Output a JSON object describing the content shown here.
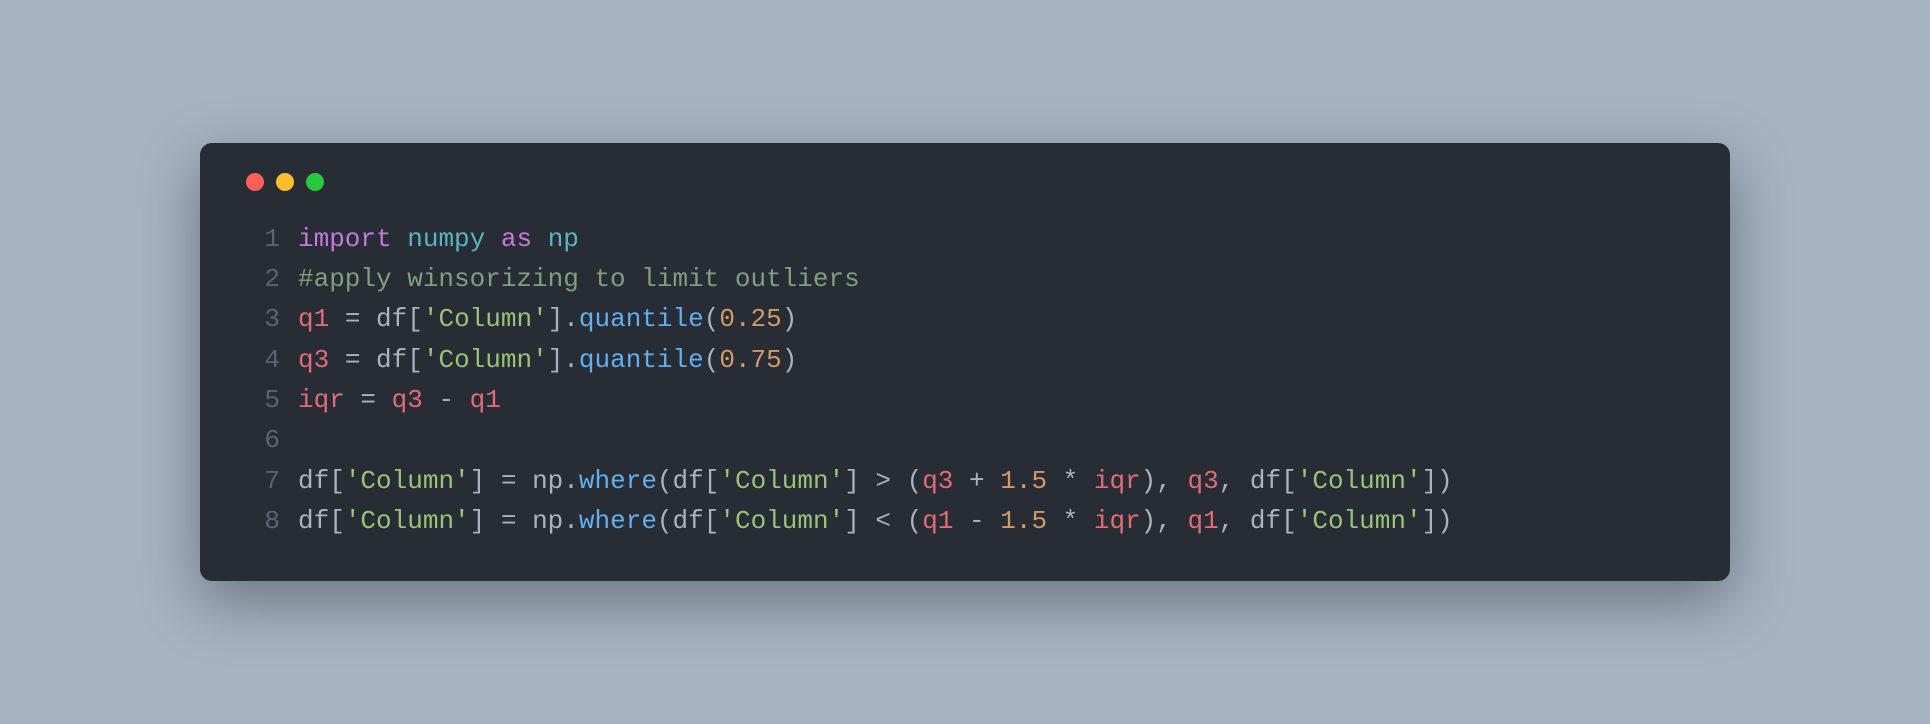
{
  "window": {
    "traffic_lights": [
      "close",
      "minimize",
      "zoom"
    ]
  },
  "code": {
    "lines": [
      {
        "n": "1",
        "tokens": [
          {
            "t": "import",
            "c": "kw"
          },
          {
            "t": " ",
            "c": "punct"
          },
          {
            "t": "numpy",
            "c": "mod"
          },
          {
            "t": " ",
            "c": "punct"
          },
          {
            "t": "as",
            "c": "as"
          },
          {
            "t": " ",
            "c": "punct"
          },
          {
            "t": "np",
            "c": "alias"
          }
        ]
      },
      {
        "n": "2",
        "tokens": [
          {
            "t": "#apply winsorizing to limit outliers",
            "c": "comment"
          }
        ]
      },
      {
        "n": "3",
        "tokens": [
          {
            "t": "q1",
            "c": "var"
          },
          {
            "t": " = ",
            "c": "op"
          },
          {
            "t": "df",
            "c": "obj"
          },
          {
            "t": "[",
            "c": "punct"
          },
          {
            "t": "'Column'",
            "c": "str"
          },
          {
            "t": "].",
            "c": "punct"
          },
          {
            "t": "quantile",
            "c": "func"
          },
          {
            "t": "(",
            "c": "punct"
          },
          {
            "t": "0.25",
            "c": "num"
          },
          {
            "t": ")",
            "c": "punct"
          }
        ]
      },
      {
        "n": "4",
        "tokens": [
          {
            "t": "q3",
            "c": "var"
          },
          {
            "t": " = ",
            "c": "op"
          },
          {
            "t": "df",
            "c": "obj"
          },
          {
            "t": "[",
            "c": "punct"
          },
          {
            "t": "'Column'",
            "c": "str"
          },
          {
            "t": "].",
            "c": "punct"
          },
          {
            "t": "quantile",
            "c": "func"
          },
          {
            "t": "(",
            "c": "punct"
          },
          {
            "t": "0.75",
            "c": "num"
          },
          {
            "t": ")",
            "c": "punct"
          }
        ]
      },
      {
        "n": "5",
        "tokens": [
          {
            "t": "iqr",
            "c": "var"
          },
          {
            "t": " = ",
            "c": "op"
          },
          {
            "t": "q3",
            "c": "var"
          },
          {
            "t": " - ",
            "c": "op"
          },
          {
            "t": "q1",
            "c": "var"
          }
        ]
      },
      {
        "n": "6",
        "tokens": [
          {
            "t": "",
            "c": "punct"
          }
        ]
      },
      {
        "n": "7",
        "tokens": [
          {
            "t": "df",
            "c": "obj"
          },
          {
            "t": "[",
            "c": "punct"
          },
          {
            "t": "'Column'",
            "c": "str"
          },
          {
            "t": "] = ",
            "c": "op"
          },
          {
            "t": "np",
            "c": "np"
          },
          {
            "t": ".",
            "c": "punct"
          },
          {
            "t": "where",
            "c": "func"
          },
          {
            "t": "(",
            "c": "punct"
          },
          {
            "t": "df",
            "c": "obj"
          },
          {
            "t": "[",
            "c": "punct"
          },
          {
            "t": "'Column'",
            "c": "str"
          },
          {
            "t": "] > (",
            "c": "op"
          },
          {
            "t": "q3",
            "c": "var"
          },
          {
            "t": " + ",
            "c": "op"
          },
          {
            "t": "1.5",
            "c": "num"
          },
          {
            "t": " * ",
            "c": "op"
          },
          {
            "t": "iqr",
            "c": "var"
          },
          {
            "t": "), ",
            "c": "punct"
          },
          {
            "t": "q3",
            "c": "var"
          },
          {
            "t": ", ",
            "c": "punct"
          },
          {
            "t": "df",
            "c": "obj"
          },
          {
            "t": "[",
            "c": "punct"
          },
          {
            "t": "'Column'",
            "c": "str"
          },
          {
            "t": "])",
            "c": "punct"
          }
        ]
      },
      {
        "n": "8",
        "tokens": [
          {
            "t": "df",
            "c": "obj"
          },
          {
            "t": "[",
            "c": "punct"
          },
          {
            "t": "'Column'",
            "c": "str"
          },
          {
            "t": "] = ",
            "c": "op"
          },
          {
            "t": "np",
            "c": "np"
          },
          {
            "t": ".",
            "c": "punct"
          },
          {
            "t": "where",
            "c": "func"
          },
          {
            "t": "(",
            "c": "punct"
          },
          {
            "t": "df",
            "c": "obj"
          },
          {
            "t": "[",
            "c": "punct"
          },
          {
            "t": "'Column'",
            "c": "str"
          },
          {
            "t": "] < (",
            "c": "op"
          },
          {
            "t": "q1",
            "c": "var"
          },
          {
            "t": " - ",
            "c": "op"
          },
          {
            "t": "1.5",
            "c": "num"
          },
          {
            "t": " * ",
            "c": "op"
          },
          {
            "t": "iqr",
            "c": "var"
          },
          {
            "t": "), ",
            "c": "punct"
          },
          {
            "t": "q1",
            "c": "var"
          },
          {
            "t": ", ",
            "c": "punct"
          },
          {
            "t": "df",
            "c": "obj"
          },
          {
            "t": "[",
            "c": "punct"
          },
          {
            "t": "'Column'",
            "c": "str"
          },
          {
            "t": "])",
            "c": "punct"
          }
        ]
      }
    ]
  }
}
